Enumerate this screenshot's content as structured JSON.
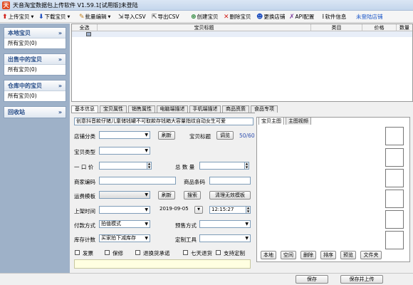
{
  "window": {
    "title": "天音淘宝数据包上传软件 V1.59.1[试用版]未登陆"
  },
  "toolbar": {
    "upload": "上传宝贝",
    "download": "下载宝贝",
    "batch_edit": "批量编辑",
    "import_csv": "导入CSV",
    "export_csv": "导出CSV",
    "create": "创建宝贝",
    "delete": "删除宝贝",
    "change_store": "更换店铺",
    "api": "API配置",
    "software_info": "软件信息",
    "login_status": "未登陆店铺"
  },
  "sidebar": {
    "local": {
      "title": "本地宝贝",
      "item": "所有宝贝(0)"
    },
    "selling": {
      "title": "出售中的宝贝",
      "item": "所有宝贝(0)"
    },
    "warehouse": {
      "title": "仓库中的宝贝",
      "item": "所有宝贝(0)"
    },
    "recycle": {
      "title": "回收站"
    }
  },
  "grid": {
    "columns": [
      "全选",
      "宝贝标题",
      "类目",
      "价格",
      "数量"
    ]
  },
  "tabs": [
    "基本信息",
    "宝贝属性",
    "销售属性",
    "电脑端描述",
    "手机端描述",
    "商品资质",
    "食品专项"
  ],
  "form": {
    "title_value": "创意抖音款仔猪儿童储钱罐不可取款存钱箱大容量指纹自动女生可爱",
    "store_category": "店铺分类",
    "refresh": "刷新",
    "title_label": "宝贝标题",
    "preview": "调览",
    "title_count": "50/60",
    "type_label": "宝贝类型",
    "price_label": "一 口 价",
    "qty_label": "总 数 量",
    "merchant_code": "商家编码",
    "barcode": "商品条码",
    "shipping_template": "运费模板",
    "refresh2": "刷新",
    "search": "搜索",
    "clear_invalid": "清理无效模板",
    "listing_time": "上架时间",
    "date": "2019-09-05",
    "time": "12:15:27",
    "payment": "付款方式",
    "payment_value": "拍值模式",
    "presale": "预售方式",
    "stock_count": "库存计数",
    "stock_value": "买家拍下减库存",
    "custom_tool": "定制工具",
    "invoice": "发票",
    "warranty": "保修",
    "refund_promise": "退换货承诺",
    "seven_day": "七天退货",
    "support_custom": "支持定制"
  },
  "image_panel": {
    "tab_main": "宝贝主图",
    "tab_video": "主图视频",
    "buttons": [
      "本地",
      "空间",
      "删除",
      "排序",
      "预览",
      "文件夹"
    ]
  },
  "footer": {
    "save": "保存",
    "save_upload": "保存并上传"
  }
}
